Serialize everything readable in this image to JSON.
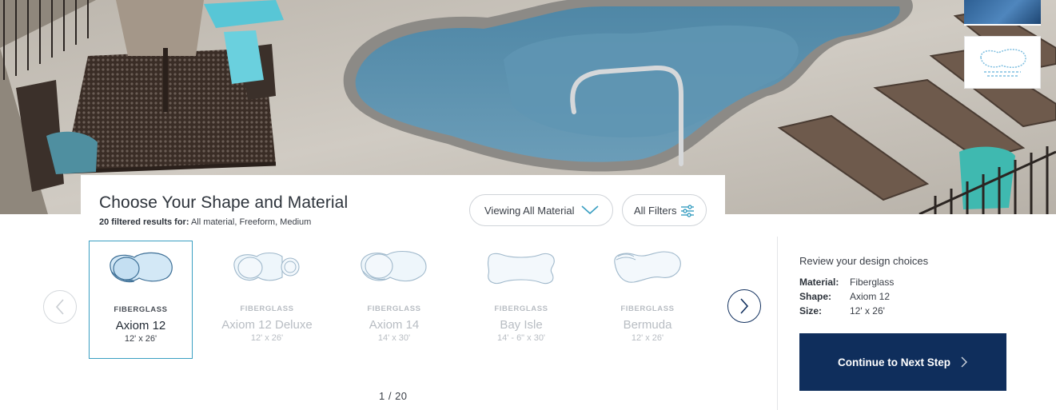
{
  "hero": {
    "image": "backyard-fiberglass-pool-photo"
  },
  "header": {
    "title": "Choose Your Shape and Material",
    "results_label": "20 filtered results for:",
    "results_filters": "All material, Freeform, Medium"
  },
  "controls": {
    "material_dropdown": "Viewing All Material",
    "filters_button": "All Filters"
  },
  "carousel": {
    "items": [
      {
        "material": "FIBERGLASS",
        "name": "Axiom 12",
        "size": "12' x 26'",
        "selected": true
      },
      {
        "material": "FIBERGLASS",
        "name": "Axiom 12 Deluxe",
        "size": "12' x 26'",
        "selected": false
      },
      {
        "material": "FIBERGLASS",
        "name": "Axiom 14",
        "size": "14' x 30'",
        "selected": false
      },
      {
        "material": "FIBERGLASS",
        "name": "Bay Isle",
        "size": "14' - 6\" x 30'",
        "selected": false
      },
      {
        "material": "FIBERGLASS",
        "name": "Bermuda",
        "size": "12' x 26'",
        "selected": false
      }
    ],
    "pager": "1 / 20"
  },
  "summary": {
    "title": "Review your design choices",
    "rows": [
      {
        "label": "Material:",
        "value": "Fiberglass"
      },
      {
        "label": "Shape:",
        "value": "Axiom 12"
      },
      {
        "label": "Size:",
        "value": "12' x 26'"
      }
    ],
    "cta": "Continue to Next Step"
  },
  "colors": {
    "navy": "#0f2e5c",
    "selected_border": "#3a9fc2",
    "muted_text": "#b8bdc3",
    "pool_water": "#5b8fae"
  }
}
